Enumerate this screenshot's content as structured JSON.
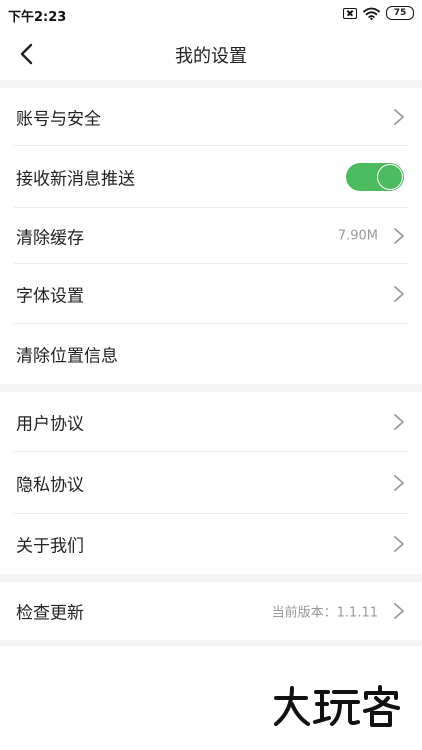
{
  "status_bar": {
    "time": "下午2:23",
    "battery": "75"
  },
  "header": {
    "title": "我的设置"
  },
  "settings": {
    "account_security": {
      "label": "账号与安全"
    },
    "push_notifications": {
      "label": "接收新消息推送",
      "enabled": true
    },
    "clear_cache": {
      "label": "清除缓存",
      "value": "7.90M"
    },
    "font_settings": {
      "label": "字体设置"
    },
    "clear_location": {
      "label": "清除位置信息"
    },
    "user_agreement": {
      "label": "用户协议"
    },
    "privacy_agreement": {
      "label": "隐私协议"
    },
    "about_us": {
      "label": "关于我们"
    },
    "check_update": {
      "label": "检查更新",
      "value": "当前版本：1.1.11"
    }
  },
  "watermark": {
    "text": "大玩客"
  },
  "colors": {
    "accent_green": "#4cbb5f",
    "section_gap": "#f5f5f5"
  },
  "icons": [
    "sim-no-signal-icon",
    "wifi-icon",
    "battery-icon",
    "back-arrow-icon",
    "chevron-right-icon"
  ]
}
